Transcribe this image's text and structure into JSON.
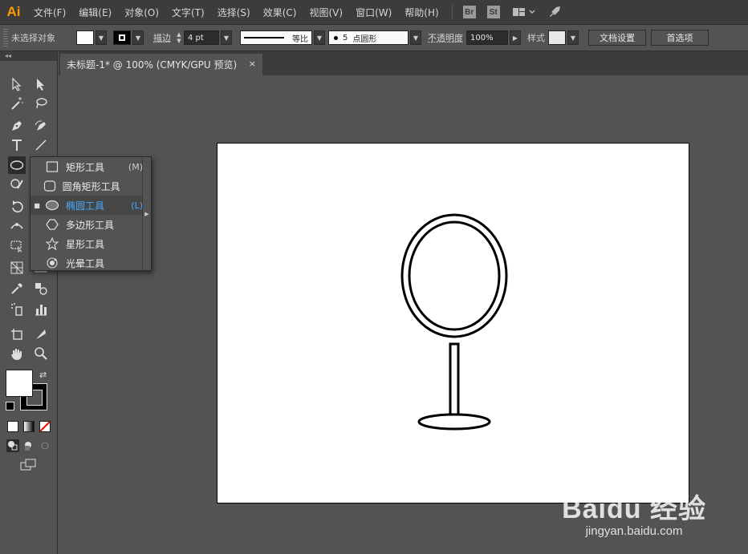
{
  "menubar": {
    "logo": "Ai",
    "items": [
      "文件(F)",
      "编辑(E)",
      "对象(O)",
      "文字(T)",
      "选择(S)",
      "效果(C)",
      "视图(V)",
      "窗口(W)",
      "帮助(H)"
    ],
    "bridge_badge": "Br",
    "stock_badge": "St"
  },
  "controlbar": {
    "selection_status": "未选择对象",
    "stroke_label": "描边",
    "stroke_weight": "4 pt",
    "variable_width_label": "等比",
    "brush_value": "5",
    "brush_label": "点圆形",
    "opacity_label": "不透明度",
    "opacity_value": "100%",
    "style_label": "样式",
    "document_setup_button": "文档设置",
    "preferences_button": "首选项"
  },
  "toolbox": {
    "collapse_glyph": "◂◂"
  },
  "document": {
    "tab_title": "未标题-1* @ 100% (CMYK/GPU 预览)",
    "close_glyph": "×"
  },
  "flyout": {
    "items": [
      {
        "label": "矩形工具",
        "shortcut": "(M)",
        "icon": "rectangle-icon",
        "selected": false
      },
      {
        "label": "圆角矩形工具",
        "shortcut": "",
        "icon": "rounded-rectangle-icon",
        "selected": false
      },
      {
        "label": "椭圆工具",
        "shortcut": "(L)",
        "icon": "ellipse-icon",
        "selected": true
      },
      {
        "label": "多边形工具",
        "shortcut": "",
        "icon": "polygon-icon",
        "selected": false
      },
      {
        "label": "星形工具",
        "shortcut": "",
        "icon": "star-icon",
        "selected": false
      },
      {
        "label": "光晕工具",
        "shortcut": "",
        "icon": "flare-icon",
        "selected": false
      }
    ],
    "selected_bullet": "■"
  },
  "watermark": {
    "brand": "Baidu 经验",
    "url": "jingyan.baidu.com"
  },
  "colors": {
    "accent_selected": "#4aa8ff",
    "logo": "#ff9a00",
    "panel": "#535353",
    "bar": "#3c3c3c"
  }
}
